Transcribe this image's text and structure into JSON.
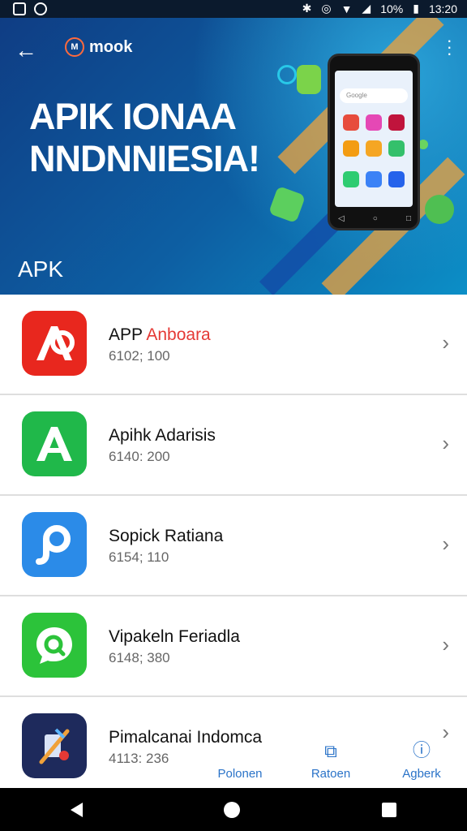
{
  "status_bar": {
    "battery": "10%",
    "time": "13:20"
  },
  "hero": {
    "brand": "mook",
    "headline_line1": "APIK IONAA",
    "headline_line2": "NNDNNIESIA!",
    "section_label": "APK",
    "phone_search": "Google"
  },
  "apps": [
    {
      "name_main": "APP",
      "name_accent": "Anboara",
      "meta": "6102; 100",
      "icon": "app-a-red-icon",
      "color": "#e8271e"
    },
    {
      "name_main": "Apihk Adarisis",
      "name_accent": "",
      "meta": "6140: 200",
      "icon": "app-a-green-icon",
      "color": "#20b84a"
    },
    {
      "name_main": "Sopick Ratiana",
      "name_accent": "",
      "meta": "6154; 110",
      "icon": "app-p-blue-icon",
      "color": "#2b8be8"
    },
    {
      "name_main": "Vipakeln Feriadla",
      "name_accent": "",
      "meta": "6148; 380",
      "icon": "app-chat-green-icon",
      "color": "#2cc33a"
    },
    {
      "name_main": "Pimalcanai Indomca",
      "name_accent": "",
      "meta": "4113: 236",
      "icon": "app-tools-navy-icon",
      "color": "#1e2a5c"
    }
  ],
  "bottom_tabs": [
    {
      "label": "Polonen",
      "icon": "tab-home-icon"
    },
    {
      "label": "Ratoen",
      "icon": "tab-edit-icon"
    },
    {
      "label": "Agberk",
      "icon": "tab-info-icon"
    }
  ]
}
